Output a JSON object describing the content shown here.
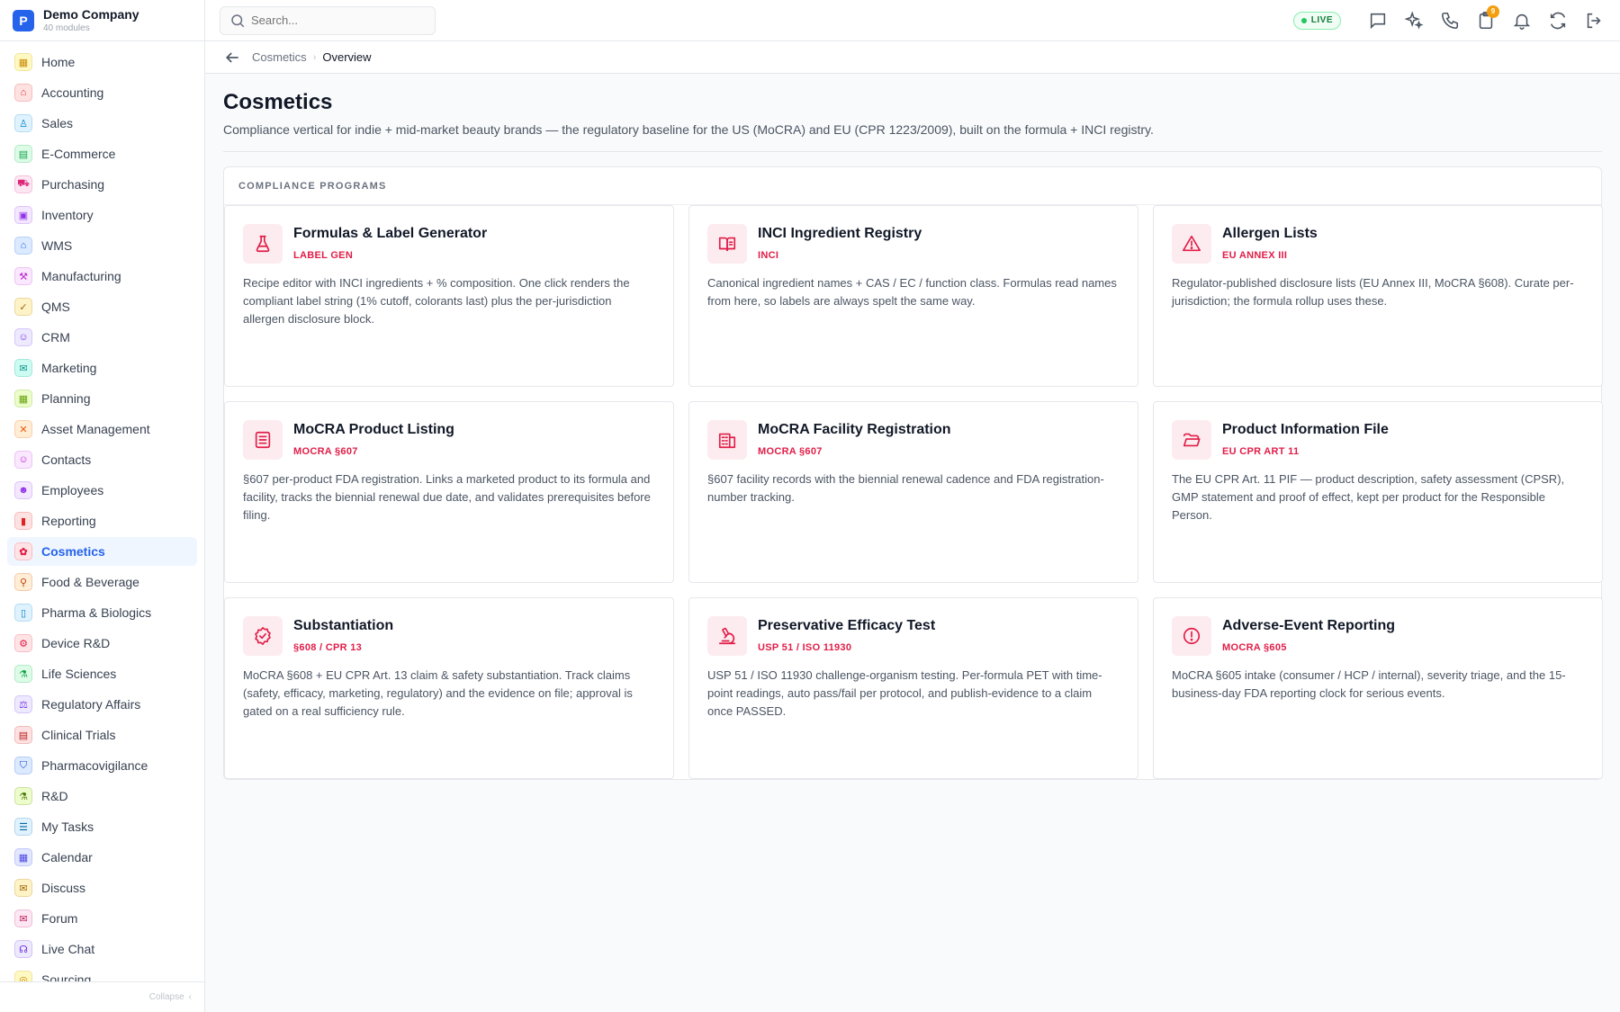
{
  "brand": {
    "logo_letter": "P",
    "name": "Demo Company",
    "subtitle": "40 modules"
  },
  "sidebar": {
    "items": [
      {
        "label": "Home",
        "icon": "home-icon",
        "color": "#ca8a04",
        "bg": "#fef9c3",
        "glyph": "▦"
      },
      {
        "label": "Accounting",
        "icon": "bank-icon",
        "color": "#dc2626",
        "bg": "#fee2e2",
        "glyph": "⌂"
      },
      {
        "label": "Sales",
        "icon": "sales-icon",
        "color": "#0284c7",
        "bg": "#e0f2fe",
        "glyph": "♙"
      },
      {
        "label": "E-Commerce",
        "icon": "store-icon",
        "color": "#16a34a",
        "bg": "#dcfce7",
        "glyph": "▤"
      },
      {
        "label": "Purchasing",
        "icon": "cart-icon",
        "color": "#db2777",
        "bg": "#fce7f3",
        "glyph": "⛟"
      },
      {
        "label": "Inventory",
        "icon": "box-icon",
        "color": "#9333ea",
        "bg": "#f3e8ff",
        "glyph": "▣"
      },
      {
        "label": "WMS",
        "icon": "warehouse-icon",
        "color": "#2563eb",
        "bg": "#dbeafe",
        "glyph": "⌂"
      },
      {
        "label": "Manufacturing",
        "icon": "factory-icon",
        "color": "#c026d3",
        "bg": "#fae8ff",
        "glyph": "⚒"
      },
      {
        "label": "QMS",
        "icon": "badge-check-icon",
        "color": "#a16207",
        "bg": "#fef3c7",
        "glyph": "✓"
      },
      {
        "label": "CRM",
        "icon": "users-icon",
        "color": "#7c3aed",
        "bg": "#ede9fe",
        "glyph": "☺"
      },
      {
        "label": "Marketing",
        "icon": "megaphone-icon",
        "color": "#0d9488",
        "bg": "#ccfbf1",
        "glyph": "✉"
      },
      {
        "label": "Planning",
        "icon": "calendar-plan-icon",
        "color": "#65a30d",
        "bg": "#ecfccb",
        "glyph": "▦"
      },
      {
        "label": "Asset Management",
        "icon": "tools-icon",
        "color": "#ea580c",
        "bg": "#ffedd5",
        "glyph": "✕"
      },
      {
        "label": "Contacts",
        "icon": "contact-icon",
        "color": "#c026d3",
        "bg": "#fae8ff",
        "glyph": "☺"
      },
      {
        "label": "Employees",
        "icon": "employees-icon",
        "color": "#9333ea",
        "bg": "#f3e8ff",
        "glyph": "☻"
      },
      {
        "label": "Reporting",
        "icon": "bar-chart-icon",
        "color": "#dc2626",
        "bg": "#fee2e2",
        "glyph": "▮"
      },
      {
        "label": "Cosmetics",
        "icon": "lotus-icon",
        "color": "#e11d48",
        "bg": "#ffe4e6",
        "glyph": "✿",
        "active": true
      },
      {
        "label": "Food & Beverage",
        "icon": "utensils-icon",
        "color": "#c2410c",
        "bg": "#ffedd5",
        "glyph": "⚲"
      },
      {
        "label": "Pharma & Biologics",
        "icon": "pill-icon",
        "color": "#0284c7",
        "bg": "#e0f2fe",
        "glyph": "▯"
      },
      {
        "label": "Device R&D",
        "icon": "device-icon",
        "color": "#e11d48",
        "bg": "#ffe4e6",
        "glyph": "⚙"
      },
      {
        "label": "Life Sciences",
        "icon": "microscope-icon",
        "color": "#16a34a",
        "bg": "#dcfce7",
        "glyph": "⚗"
      },
      {
        "label": "Regulatory Affairs",
        "icon": "gavel-icon",
        "color": "#7c3aed",
        "bg": "#ede9fe",
        "glyph": "⚖"
      },
      {
        "label": "Clinical Trials",
        "icon": "clipboard-icon",
        "color": "#b91c1c",
        "bg": "#fee2e2",
        "glyph": "▤"
      },
      {
        "label": "Pharmacovigilance",
        "icon": "shield-icon",
        "color": "#1d4ed8",
        "bg": "#dbeafe",
        "glyph": "⛉"
      },
      {
        "label": "R&D",
        "icon": "flask-icon",
        "color": "#4d7c0f",
        "bg": "#ecfccb",
        "glyph": "⚗"
      },
      {
        "label": "My Tasks",
        "icon": "checklist-icon",
        "color": "#0369a1",
        "bg": "#e0f2fe",
        "glyph": "☰"
      },
      {
        "label": "Calendar",
        "icon": "calendar-icon",
        "color": "#4f46e5",
        "bg": "#e0e7ff",
        "glyph": "▦"
      },
      {
        "label": "Discuss",
        "icon": "chat-icon",
        "color": "#a16207",
        "bg": "#fef3c7",
        "glyph": "✉"
      },
      {
        "label": "Forum",
        "icon": "forum-icon",
        "color": "#be185d",
        "bg": "#fce7f3",
        "glyph": "✉"
      },
      {
        "label": "Live Chat",
        "icon": "headset-icon",
        "color": "#6d28d9",
        "bg": "#ede9fe",
        "glyph": "☊"
      },
      {
        "label": "Sourcing",
        "icon": "sourcing-icon",
        "color": "#ca8a04",
        "bg": "#fef9c3",
        "glyph": "◎"
      }
    ],
    "collapse_label": "Collapse"
  },
  "topbar": {
    "search_placeholder": "Search...",
    "live_label": "LIVE",
    "notification_count": "9",
    "icons": [
      "chat-bubble-icon",
      "sparkles-icon",
      "phone-icon",
      "clipboard-notification-icon",
      "bell-icon",
      "sync-icon",
      "logout-icon"
    ]
  },
  "breadcrumb": {
    "parent": "Cosmetics",
    "current": "Overview"
  },
  "page": {
    "title": "Cosmetics",
    "description": "Compliance vertical for indie + mid-market beauty brands — the regulatory baseline for the US (MoCRA) and EU (CPR 1223/2009), built on the formula + INCI registry."
  },
  "programs": {
    "header": "COMPLIANCE PROGRAMS",
    "accent": "#e11d48",
    "cards": [
      {
        "title": "Formulas & Label Generator",
        "tag": "LABEL GEN",
        "icon": "flask-icon",
        "description": "Recipe editor with INCI ingredients + % composition. One click renders the compliant label string (1% cutoff, colorants last) plus the per-jurisdiction allergen disclosure block."
      },
      {
        "title": "INCI Ingredient Registry",
        "tag": "INCI",
        "icon": "book-open-icon",
        "description": "Canonical ingredient names + CAS / EC / function class. Formulas read names from here, so labels are always spelt the same way."
      },
      {
        "title": "Allergen Lists",
        "tag": "EU ANNEX III",
        "icon": "warning-triangle-icon",
        "description": "Regulator-published disclosure lists (EU Annex III, MoCRA §608). Curate per-jurisdiction; the formula rollup uses these."
      },
      {
        "title": "MoCRA Product Listing",
        "tag": "MOCRA §607",
        "icon": "list-icon",
        "description": "§607 per-product FDA registration. Links a marketed product to its formula and facility, tracks the biennial renewal due date, and validates prerequisites before filing."
      },
      {
        "title": "MoCRA Facility Registration",
        "tag": "MOCRA §607",
        "icon": "building-icon",
        "description": "§607 facility records with the biennial renewal cadence and FDA registration-number tracking."
      },
      {
        "title": "Product Information File",
        "tag": "EU CPR ART 11",
        "icon": "folder-open-icon",
        "description": "The EU CPR Art. 11 PIF — product description, safety assessment (CPSR), GMP statement and proof of effect, kept per product for the Responsible Person."
      },
      {
        "title": "Substantiation",
        "tag": "§608 / CPR 13",
        "icon": "badge-check-icon",
        "description": "MoCRA §608 + EU CPR Art. 13 claim & safety substantiation. Track claims (safety, efficacy, marketing, regulatory) and the evidence on file; approval is gated on a real sufficiency rule."
      },
      {
        "title": "Preservative Efficacy Test",
        "tag": "USP 51 / ISO 11930",
        "icon": "microscope-icon",
        "description": "USP 51 / ISO 11930 challenge-organism testing. Per-formula PET with time-point readings, auto pass/fail per protocol, and publish-evidence to a claim once PASSED."
      },
      {
        "title": "Adverse-Event Reporting",
        "tag": "MOCRA §605",
        "icon": "alert-circle-icon",
        "description": "MoCRA §605 intake (consumer / HCP / internal), severity triage, and the 15-business-day FDA reporting clock for serious events."
      }
    ]
  }
}
